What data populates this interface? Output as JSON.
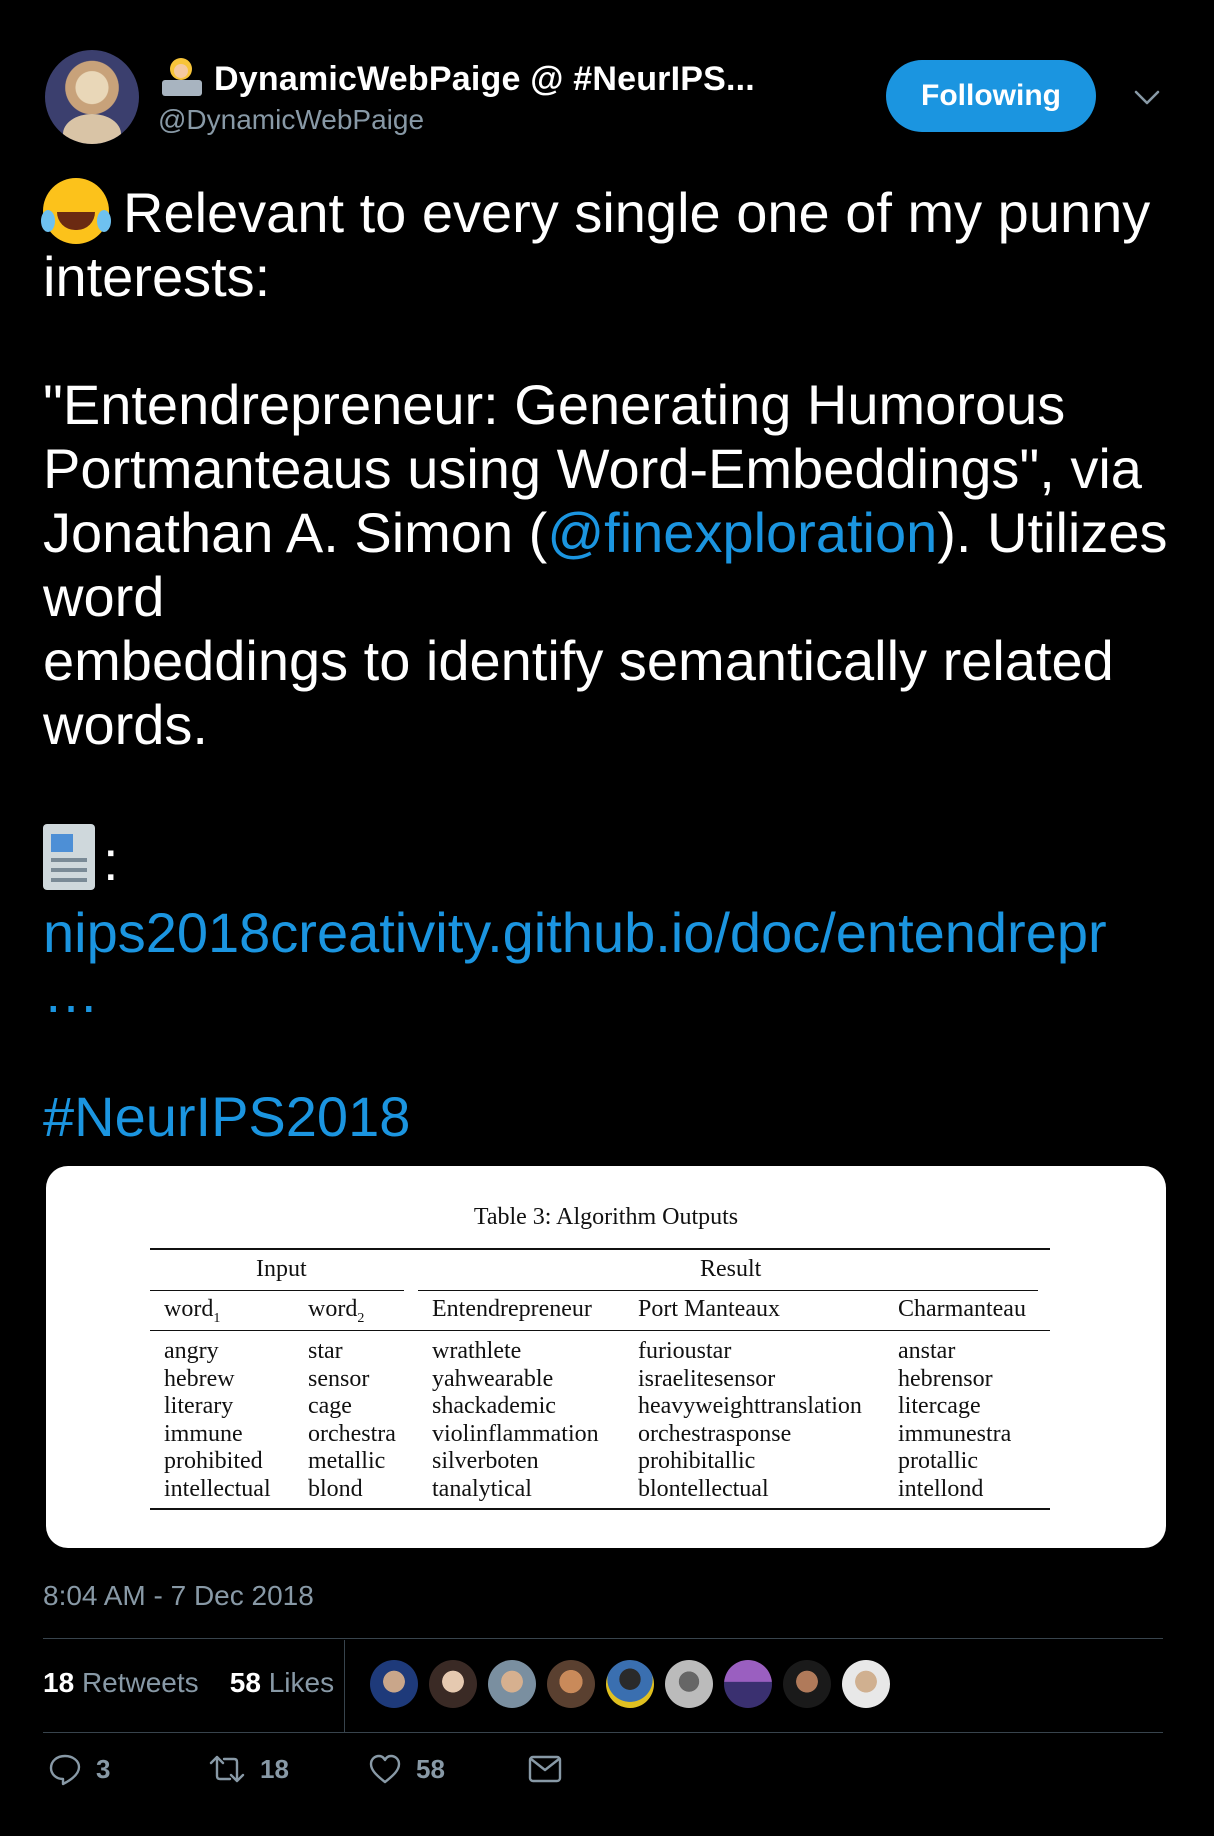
{
  "header": {
    "display_name": "DynamicWebPaige @ #NeurIPS...",
    "handle": "@DynamicWebPaige",
    "follow_button": "Following"
  },
  "tweet": {
    "line1": "Relevant to every single one of my punny",
    "line2": "interests:",
    "line3": "\"Entendrepreneur: Generating Humorous",
    "line4": "Portmanteaus using Word-Embeddings\", via",
    "line5_pre": "Jonathan A. Simon (",
    "mention": "@finexploration",
    "line5_post": "). Utilizes",
    "line6": "word",
    "line7": "embeddings to identify semantically related",
    "line8": "words.",
    "news_colon": ":",
    "link": "nips2018creativity.github.io/doc/entendrepr",
    "link_ellipsis": "…",
    "hashtag": "#NeurIPS2018"
  },
  "table": {
    "caption": "Table 3: Algorithm Outputs",
    "group_input": "Input",
    "group_result": "Result",
    "headers": {
      "word1": "word",
      "word1_sub": "1",
      "word2": "word",
      "word2_sub": "2",
      "entendrepreneur": "Entendrepreneur",
      "port_manteaux": "Port Manteaux",
      "charmanteau": "Charmanteau"
    },
    "columns": {
      "word1": "angry\nhebrew\nliterary\nimmune\nprohibited\nintellectual",
      "word2": "star\nsensor\ncage\norchestra\nmetallic\nblond",
      "entendrepreneur": "wrathlete\nyahwearable\nshackademic\nviolinflammation\nsilverboten\ntanalytical",
      "port_manteaux": "furioustar\nisraelitesensor\nheavyweighttranslation\norchestrasponse\nprohibitallic\nblontellectual",
      "charmanteau": "anstar\nhebrensor\nlitercage\nimmunestra\nprotallic\nintellond"
    }
  },
  "meta": {
    "timestamp": "8:04 AM - 7 Dec 2018",
    "retweets_count": "18",
    "retweets_label": "Retweets",
    "likes_count": "58",
    "likes_label": "Likes"
  },
  "actions": {
    "reply_count": "3",
    "retweet_count": "18",
    "like_count": "58"
  },
  "colors": {
    "background": "#000000",
    "accent": "#1b95e0",
    "muted": "#8899a6",
    "divider": "#38444d"
  },
  "icons": [
    "laptop-developer-emoji",
    "tears-of-joy-emoji",
    "newspaper-emoji",
    "chevron-down-icon",
    "reply-icon",
    "retweet-icon",
    "heart-icon",
    "envelope-icon"
  ]
}
